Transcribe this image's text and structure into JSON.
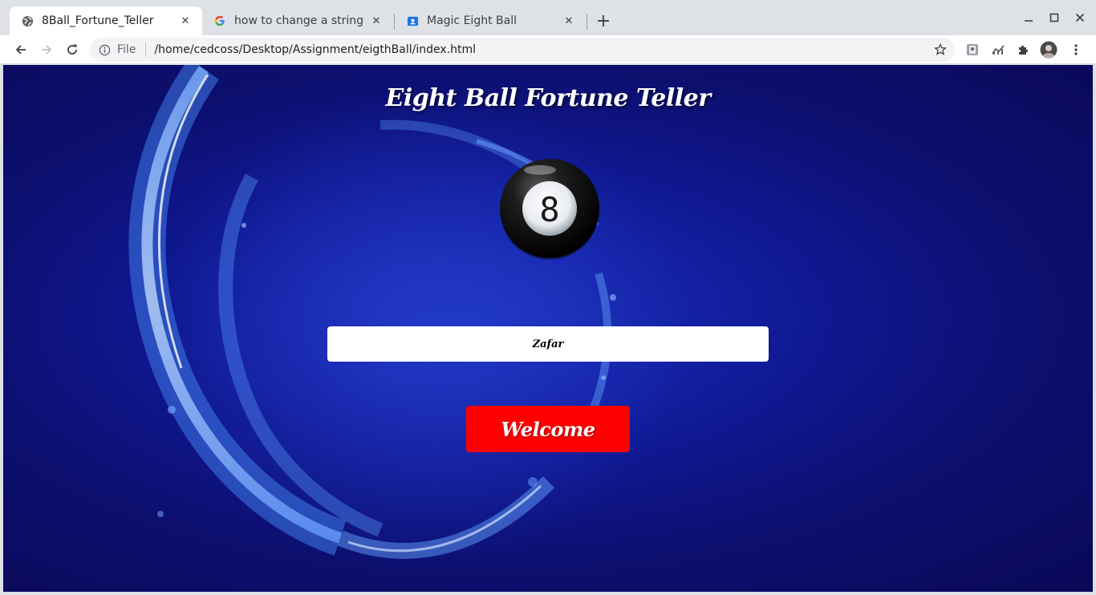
{
  "browser": {
    "tabs": [
      {
        "title": "8Ball_Fortune_Teller",
        "favicon": "globe-icon",
        "active": true
      },
      {
        "title": "how to change a string in",
        "favicon": "google-icon",
        "active": false
      },
      {
        "title": "Magic Eight Ball",
        "favicon": "contact-icon",
        "active": false
      }
    ],
    "close_glyph": "✕",
    "new_tab_glyph": "+",
    "address": {
      "scheme_label": "File",
      "url": "/home/cedcoss/Desktop/Assignment/eigthBall/index.html"
    }
  },
  "page": {
    "title": "Eight Ball Fortune Teller",
    "ball_number": "8",
    "name_input_value": "Zafar",
    "welcome_button_label": "Welcome"
  },
  "colors": {
    "background": "#0f1790",
    "button": "#fe0000",
    "input_bg": "#ffffff"
  }
}
